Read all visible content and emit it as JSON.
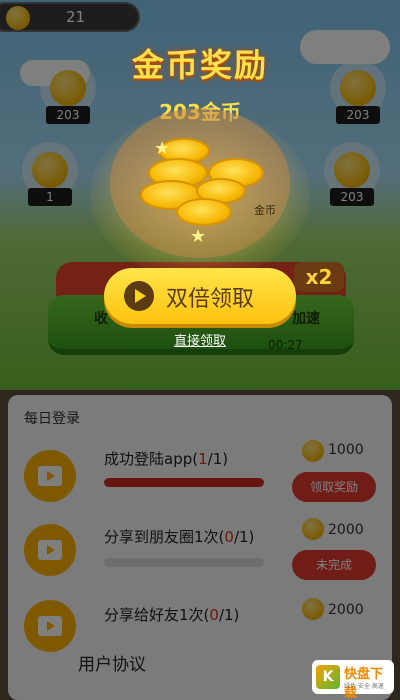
{
  "top": {
    "coins": "21"
  },
  "bubbles": [
    "203",
    "203",
    "1",
    "203"
  ],
  "field": {
    "left_label": "收",
    "right_label": "加速",
    "timer": "00:27",
    "badge": "x2"
  },
  "modal": {
    "title": "金币奖励",
    "amount": "203金币",
    "pig_label": "金币",
    "double_button": "双倍领取",
    "direct_link": "直接领取"
  },
  "panel": {
    "title": "每日登录",
    "tasks": [
      {
        "pre": "成功登陆app(",
        "done": "1",
        "post": "/1)",
        "progress": 1.0,
        "reward": "1000",
        "button": "领取奖励"
      },
      {
        "pre": "分享到朋友圈1次(",
        "done": "0",
        "post": "/1)",
        "progress": 0.0,
        "reward": "2000",
        "button": "未完成"
      },
      {
        "pre": "分享给好友1次(",
        "done": "0",
        "post": "/1)",
        "progress": 0.0,
        "reward": "2000",
        "button": ""
      }
    ]
  },
  "footer": {
    "user_protocol": "用户协议"
  },
  "watermark": {
    "logo_char": "K",
    "name": "快盘下载",
    "slogan": "绿色·安全·高速"
  },
  "colors": {
    "accent_red": "#e33a2e",
    "gold": "#ffe04a",
    "button_yellow": "#ffc20e"
  }
}
